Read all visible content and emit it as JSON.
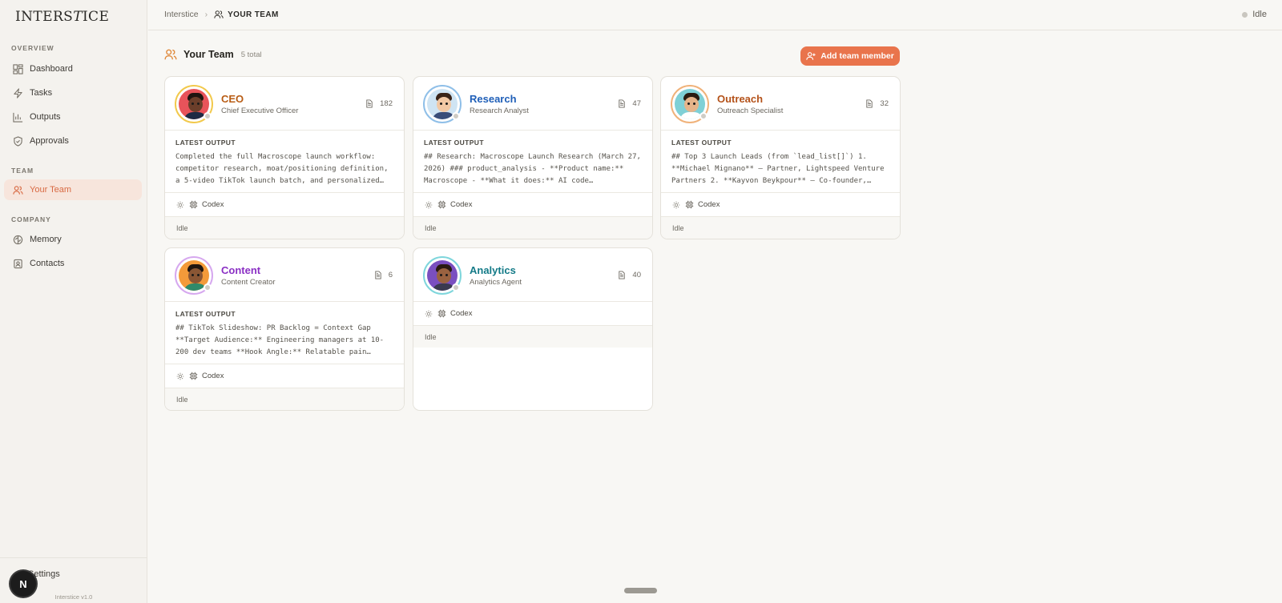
{
  "sidebar": {
    "logo": "INTERSTICE",
    "sections": {
      "overview": "OVERVIEW",
      "team": "TEAM",
      "company": "COMPANY"
    },
    "items": {
      "dashboard": "Dashboard",
      "tasks": "Tasks",
      "outputs": "Outputs",
      "approvals": "Approvals",
      "your_team": "Your Team",
      "memory": "Memory",
      "contacts": "Contacts"
    },
    "settings": "Settings",
    "version": "Interstice v1.0",
    "badge": "N"
  },
  "header": {
    "breadcrumb_root": "Interstice",
    "breadcrumb_current": "YOUR TEAM",
    "status": "Idle"
  },
  "page": {
    "title": "Your Team",
    "count": "5 total",
    "add_button": "Add team member"
  },
  "labels": {
    "latest_output": "LATEST OUTPUT",
    "runtime": "Codex",
    "state": "Idle"
  },
  "agents": [
    {
      "name": "CEO",
      "role": "Chief Executive Officer",
      "outputs": "182",
      "name_color": "#b85c14",
      "ring_color": "#f2c94c",
      "latest": "Completed the full Macroscope launch workflow: competitor research, moat/positioning definition, a 5-video TikTok launch batch, and personalized…"
    },
    {
      "name": "Research",
      "role": "Research Analyst",
      "outputs": "47",
      "name_color": "#1f5fb8",
      "ring_color": "#8fbfe8",
      "latest": "## Research: Macroscope Launch Research (March 27, 2026) ### product_analysis - **Product name:** Macroscope - **What it does:** AI code…"
    },
    {
      "name": "Outreach",
      "role": "Outreach Specialist",
      "outputs": "32",
      "name_color": "#b4521a",
      "ring_color": "#f0b27a",
      "latest": "## Top 3 Launch Leads (from `lead_list[]`) 1. **Michael Mignano** — Partner, Lightspeed Venture Partners 2. **Kayvon Beykpour** — Co-founder,…"
    },
    {
      "name": "Content",
      "role": "Content Creator",
      "outputs": "6",
      "name_color": "#8a2fc4",
      "ring_color": "#d6a8ef",
      "latest": "## TikTok Slideshow: PR Backlog = Context Gap **Target Audience:** Engineering managers at 10-200 dev teams **Hook Angle:** Relatable pain…"
    },
    {
      "name": "Analytics",
      "role": "Analytics Agent",
      "outputs": "40",
      "name_color": "#137a87",
      "ring_color": "#7fd6dc",
      "latest": ""
    }
  ]
}
